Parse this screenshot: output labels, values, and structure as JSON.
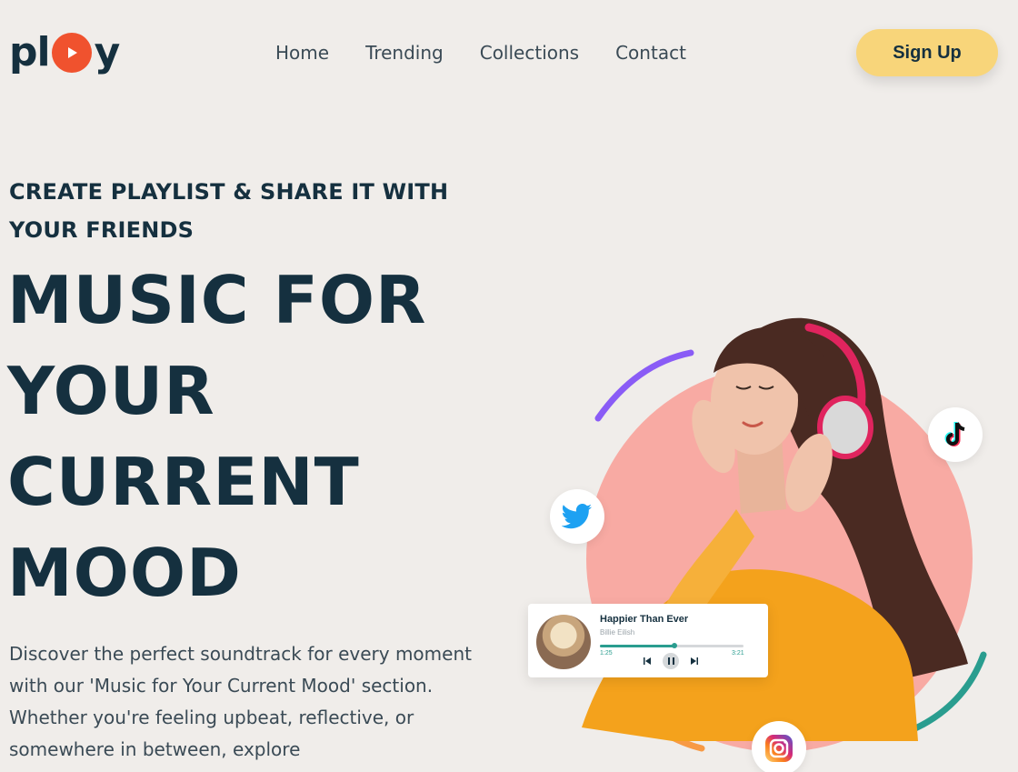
{
  "logo": {
    "prefix": "pl",
    "suffix": "y"
  },
  "nav": {
    "items": [
      "Home",
      "Trending",
      "Collections",
      "Contact"
    ]
  },
  "signup_label": "Sign Up",
  "hero": {
    "eyebrow": "CREATE PLAYLIST & SHARE IT WITH YOUR FRIENDS",
    "headline_lines": [
      "MUSIC FOR",
      "YOUR",
      "CURRENT",
      "MOOD"
    ],
    "description": "Discover the perfect soundtrack for every moment with our 'Music for Your Current Mood' section. Whether you're feeling upbeat, reflective, or somewhere in between, explore"
  },
  "player": {
    "song": "Happier Than Ever",
    "artist": "Billie Eilish",
    "elapsed": "1:25",
    "duration": "3:21",
    "progress_fraction": 0.52
  },
  "social": [
    "twitter-icon",
    "tiktok-icon",
    "instagram-icon"
  ],
  "colors": {
    "background": "#f0edea",
    "text": "#15303f",
    "accent_orange": "#f0522e",
    "button": "#f8d57a",
    "circle": "#f8aaa3",
    "teal": "#2a9d8f",
    "purple": "#8a5cf6"
  }
}
